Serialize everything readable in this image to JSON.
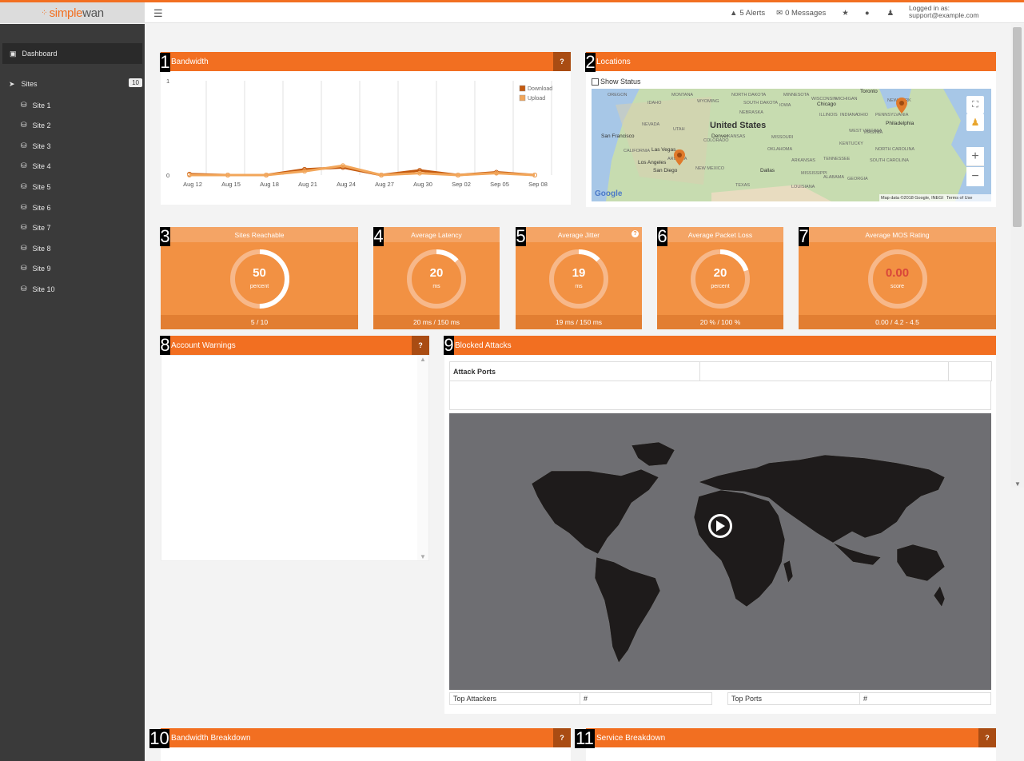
{
  "app": {
    "logo_text_orange": "simple",
    "logo_text_grey": "wan"
  },
  "topbar": {
    "alerts": "5 Alerts",
    "messages": "0 Messages",
    "login_line1": "Logged in as:",
    "login_line2": "support@example.com"
  },
  "sidebar": {
    "dashboard": "Dashboard",
    "sites": "Sites",
    "sites_count": "10",
    "items": [
      "Site 1",
      "Site 2",
      "Site 3",
      "Site 4",
      "Site 5",
      "Site 6",
      "Site 7",
      "Site 8",
      "Site 9",
      "Site 10"
    ]
  },
  "tags": [
    "1",
    "2",
    "3",
    "4",
    "5",
    "6",
    "7",
    "8",
    "9",
    "10",
    "11"
  ],
  "bandwidth": {
    "title": "Bandwidth",
    "help": "?",
    "legend": [
      "Download",
      "Upload"
    ],
    "chart_data": {
      "type": "line",
      "title": "Bandwidth",
      "categories": [
        "Aug 12",
        "Aug 15",
        "Aug 18",
        "Aug 21",
        "Aug 24",
        "Aug 27",
        "Aug 30",
        "Sep 02",
        "Sep 05",
        "Sep 08"
      ],
      "ylim": [
        0,
        1
      ],
      "yticks": [
        "0",
        "1"
      ],
      "series": [
        {
          "name": "Download",
          "color": "#c45a10",
          "values": [
            0.01,
            0,
            0,
            0.06,
            0.08,
            0,
            0.05,
            0,
            0.03,
            0
          ]
        },
        {
          "name": "Upload",
          "color": "#f2a65a",
          "values": [
            0,
            0,
            0,
            0.04,
            0.1,
            0,
            0.02,
            0,
            0.02,
            0
          ]
        }
      ]
    }
  },
  "locations": {
    "title": "Locations",
    "show_status": "Show Status",
    "map_labels": {
      "country": "United States",
      "cities": [
        "Chicago",
        "Toronto",
        "Philadelphia",
        "Las Vegas",
        "Los Angeles",
        "San Diego",
        "Dallas",
        "San Francisco",
        "Denver"
      ],
      "states": [
        "WYOMING",
        "NEBRASKA",
        "IOWA",
        "ILLINOIS",
        "INDIANA",
        "OHIO",
        "NEVADA",
        "UTAH",
        "COLORADO",
        "KANSAS",
        "MISSOURI",
        "KENTUCKY",
        "VIRGINIA",
        "OKLAHOMA",
        "TENNESSEE",
        "ARKANSAS",
        "NEW MEXICO",
        "TEXAS",
        "ALABAMA",
        "GEORGIA",
        "MISSISSIPPI",
        "LOUISIANA",
        "SOUTH CAROLINA",
        "NORTH CAROLINA",
        "ARIZONA",
        "CALIFORNIA",
        "OREGON",
        "IDAHO",
        "MONTANA",
        "NORTH DAKOTA",
        "SOUTH DAKOTA",
        "MINNESOTA",
        "WISCONSIN",
        "MICHIGAN",
        "PENNSYLVANIA",
        "NEW YORK",
        "WEST VIRGINIA"
      ]
    },
    "attribution": "Map data ©2018 Google, INEGI",
    "terms": "Terms of Use",
    "google": "Google"
  },
  "tiles": [
    {
      "title": "Sites Reachable",
      "value": "50",
      "unit": "percent",
      "footer": "5 / 10",
      "fraction": 0.5,
      "value_color": "#ffffff"
    },
    {
      "title": "Average Latency",
      "value": "20",
      "unit": "ms",
      "footer": "20 ms / 150 ms",
      "fraction": 0.133,
      "value_color": "#ffffff"
    },
    {
      "title": "Average Jitter",
      "value": "19",
      "unit": "ms",
      "footer": "19 ms / 150 ms",
      "fraction": 0.127,
      "value_color": "#ffffff"
    },
    {
      "title": "Average Packet Loss",
      "value": "20",
      "unit": "percent",
      "footer": "20 % / 100 %",
      "fraction": 0.2,
      "value_color": "#ffffff"
    },
    {
      "title": "Average MOS Rating",
      "value": "0.00",
      "unit": "score",
      "footer": "0.00 / 4.2 - 4.5",
      "fraction": 0,
      "value_color": "#d9463a"
    }
  ],
  "account_warnings": {
    "title": "Account Warnings",
    "help": "?"
  },
  "blocked_attacks": {
    "title": "Blocked Attacks",
    "attack_ports": "Attack Ports",
    "top_attackers": "Top Attackers",
    "top_ports": "Top Ports",
    "hash": "#"
  },
  "bandwidth_breakdown": {
    "title": "Bandwidth Breakdown",
    "help": "?"
  },
  "service_breakdown": {
    "title": "Service Breakdown",
    "help": "?"
  }
}
